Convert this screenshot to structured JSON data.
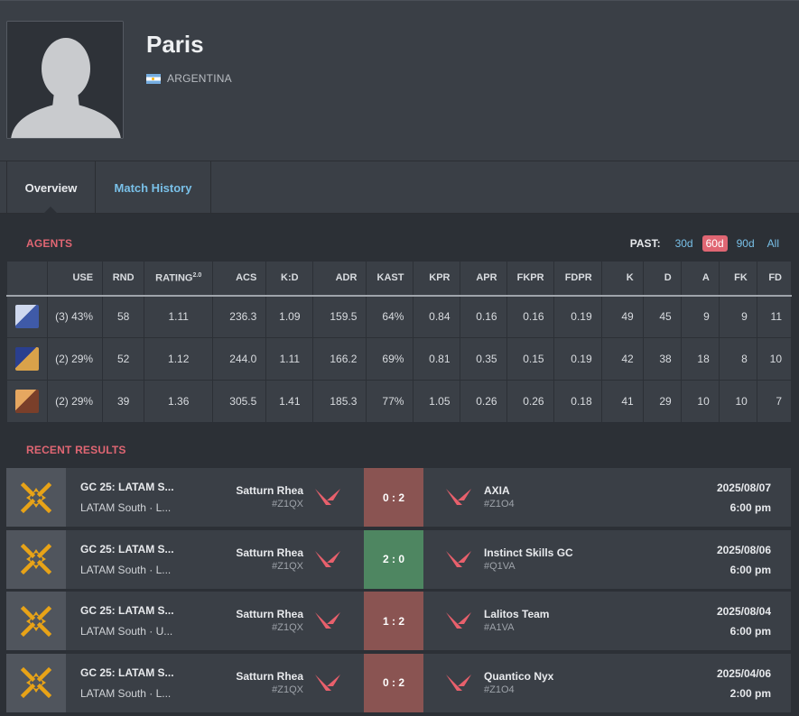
{
  "player": {
    "name": "Paris",
    "country": "ARGENTINA"
  },
  "tabs": [
    {
      "label": "Overview"
    },
    {
      "label": "Match History"
    }
  ],
  "agents_section": {
    "title": "AGENTS",
    "past_label": "PAST:",
    "past_options": [
      "30d",
      "60d",
      "90d",
      "All"
    ],
    "active_past": "60d",
    "columns": [
      "",
      "USE",
      "RND",
      "RATING",
      "ACS",
      "K:D",
      "ADR",
      "KAST",
      "KPR",
      "APR",
      "FKPR",
      "FDPR",
      "K",
      "D",
      "A",
      "FK",
      "FD"
    ],
    "rating_sup": "2.0",
    "rows": [
      {
        "icon": "agent-icon-1",
        "cells": [
          "(3) 43%",
          "58",
          "1.11",
          "236.3",
          "1.09",
          "159.5",
          "64%",
          "0.84",
          "0.16",
          "0.16",
          "0.19",
          "49",
          "45",
          "9",
          "9",
          "11"
        ]
      },
      {
        "icon": "agent-icon-2",
        "cells": [
          "(2) 29%",
          "52",
          "1.12",
          "244.0",
          "1.11",
          "166.2",
          "69%",
          "0.81",
          "0.35",
          "0.15",
          "0.19",
          "42",
          "38",
          "18",
          "8",
          "10"
        ]
      },
      {
        "icon": "agent-icon-3",
        "cells": [
          "(2) 29%",
          "39",
          "1.36",
          "305.5",
          "1.41",
          "185.3",
          "77%",
          "1.05",
          "0.26",
          "0.26",
          "0.18",
          "41",
          "29",
          "10",
          "10",
          "7"
        ]
      }
    ]
  },
  "results_section": {
    "title": "RECENT RESULTS",
    "results": [
      {
        "event": "GC 25: LATAM S...",
        "stage": "LATAM South · L...",
        "team1": "Satturn Rhea",
        "team1_tag": "#Z1QX",
        "score": "0 : 2",
        "outcome": "loss",
        "team2": "AXIA",
        "team2_tag": "#Z1O4",
        "date": "2025/08/07",
        "time": "6:00 pm"
      },
      {
        "event": "GC 25: LATAM S...",
        "stage": "LATAM South · L...",
        "team1": "Satturn Rhea",
        "team1_tag": "#Z1QX",
        "score": "2 : 0",
        "outcome": "win",
        "team2": "Instinct Skills GC",
        "team2_tag": "#Q1VA",
        "date": "2025/08/06",
        "time": "6:00 pm"
      },
      {
        "event": "GC 25: LATAM S...",
        "stage": "LATAM South · U...",
        "team1": "Satturn Rhea",
        "team1_tag": "#Z1QX",
        "score": "1 : 2",
        "outcome": "loss",
        "team2": "Lalitos Team",
        "team2_tag": "#A1VA",
        "date": "2025/08/04",
        "time": "6:00 pm"
      },
      {
        "event": "GC 25: LATAM S...",
        "stage": "LATAM South · L...",
        "team1": "Satturn Rhea",
        "team1_tag": "#Z1QX",
        "score": "0 : 2",
        "outcome": "loss",
        "team2": "Quantico Nyx",
        "team2_tag": "#Z1O4",
        "date": "2025/04/06",
        "time": "2:00 pm"
      }
    ]
  },
  "colors": {
    "accent": "#e06673",
    "link": "#79c0e8",
    "win": "#4e8661",
    "loss": "#8a5452",
    "event_logo": "#e8a317"
  }
}
